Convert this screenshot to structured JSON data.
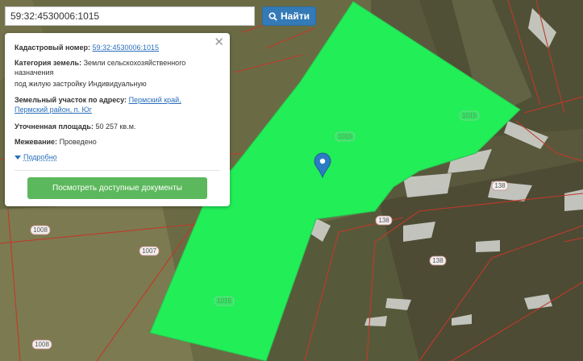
{
  "search": {
    "query": "59:32:4530006:1015",
    "button_label": "Найти"
  },
  "popup": {
    "cadastral_label": "Кадастровый номер:",
    "cadastral_value": "59:32:4530006:1015",
    "category_label": "Категория земель:",
    "category_value": "Земли сельскохозяйственного назначения",
    "category_use": "под жилую застройку Индивидуальную",
    "address_label": "Земельный участок по адресу:",
    "address_line1": "Пермский край,",
    "address_line2": "Пермский район, п. Юг",
    "area_label": "Уточненная площадь:",
    "area_value": "50 257 кв.м.",
    "survey_label": "Межевание:",
    "survey_value": "Проведено",
    "details_link": "Подробно",
    "docs_button": "Посмотреть доступные документы",
    "close_symbol": "✕"
  },
  "map": {
    "parcel_color": "#22ee58",
    "border_color": "#c0392b",
    "marker_color": "#2c7bc4",
    "labels": {
      "l1015a": "1015",
      "l1015b": "1015",
      "l1015c": "1015",
      "l1008a": "1008",
      "l1008b": "1008",
      "l1007": "1007",
      "l138a": "138",
      "l138b": "138",
      "l138c": "138"
    }
  }
}
